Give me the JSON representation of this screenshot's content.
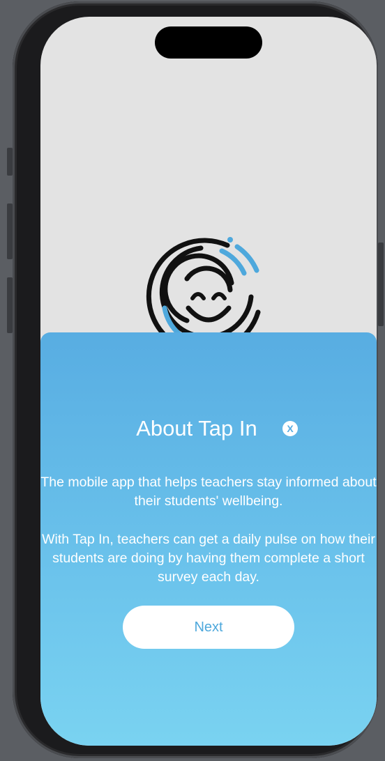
{
  "colors": {
    "accent": "#4ea8dc",
    "sheet_top": "#58ade2",
    "sheet_bottom": "#7ad3f1",
    "background": "#e3e3e3"
  },
  "logo": {
    "icon": "smiley-fingerprint-logo"
  },
  "sheet": {
    "title": "About Tap In",
    "close_label": "X",
    "paragraph_1": "The mobile app that helps teachers stay informed about their students' wellbeing.",
    "paragraph_2": "With Tap In, teachers can get a daily pulse on how their students are doing by having them complete a short survey each day.",
    "next_label": "Next"
  }
}
